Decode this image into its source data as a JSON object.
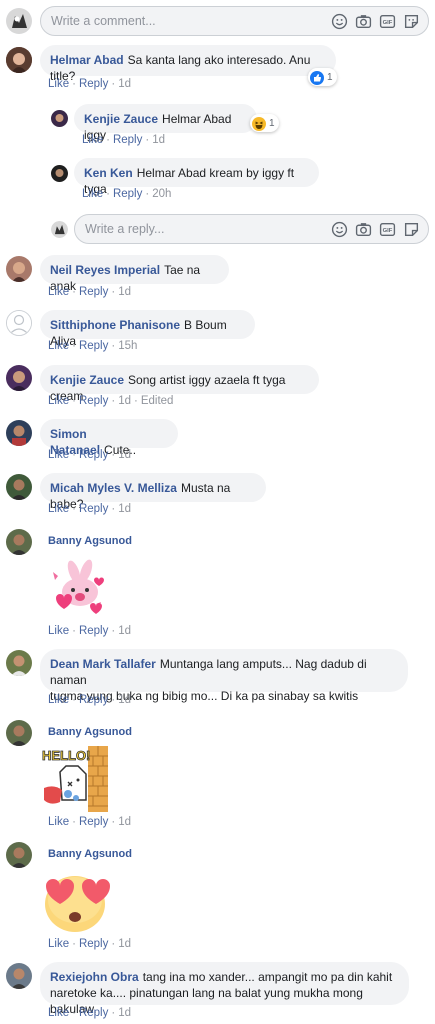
{
  "top_input": {
    "placeholder": "Write a comment..."
  },
  "reply_input": {
    "placeholder": "Write a reply..."
  },
  "actions": {
    "like": "Like",
    "reply": "Reply",
    "dot": "·"
  },
  "comments": {
    "c1": {
      "name": "Helmar Abad",
      "text": "Sa kanta lang ako interesado. Anu title?",
      "time": "1d",
      "reaction_count": "1"
    },
    "r1": {
      "name": "Kenjie Zauce",
      "text": "Helmar Abad iggy",
      "time": "1d",
      "reaction_count": "1"
    },
    "r2": {
      "name": "Ken Ken",
      "text": "Helmar Abad kream by iggy ft tyga",
      "time": "20h"
    },
    "c2": {
      "name": "Neil Reyes Imperial",
      "text": "Tae na anak",
      "time": "1d"
    },
    "c3": {
      "name": "Sitthiphone Phanisone",
      "text": "B Boum Aliya",
      "time": "15h"
    },
    "c4": {
      "name": "Kenjie Zauce",
      "text": "Song artist iggy azaela ft tyga cream",
      "time": "1d",
      "edited": "Edited"
    },
    "c5": {
      "name": "Simon Natanael",
      "text": "Cute..",
      "time": "1d"
    },
    "c6": {
      "name": "Micah Myles V. Melliza",
      "text": "Musta na babe?",
      "time": "1d"
    },
    "c7": {
      "name": "Banny Agsunod",
      "time": "1d"
    },
    "c8": {
      "name": "Dean Mark Tallafer",
      "line1": "Muntanga lang amputs... Nag dadub di naman",
      "line2": "tugma yung buka ng bibig mo... Di ka pa sinabay sa kwitis",
      "time": "1d"
    },
    "c9": {
      "name": "Banny Agsunod",
      "time": "1d",
      "sticker_text": "HELLO!"
    },
    "c10": {
      "name": "Banny Agsunod",
      "time": "1d"
    },
    "c11": {
      "name": "Rexiejohn Obra",
      "line1": "tang ina mo xander... ampangit mo pa din kahit",
      "line2": "naretoke ka.... pinatungan lang na balat yung mukha mong bakulaw.",
      "time": "1d"
    }
  },
  "colors": {
    "link": "#385898",
    "bubble": "#f2f3f5",
    "meta": "#90949c",
    "like_blue": "#1877f2",
    "haha_yellow": "#f7b928"
  },
  "icons": [
    "emoji-icon",
    "camera-icon",
    "gif-icon",
    "sticker-icon",
    "like-reaction-icon",
    "haha-reaction-icon"
  ]
}
